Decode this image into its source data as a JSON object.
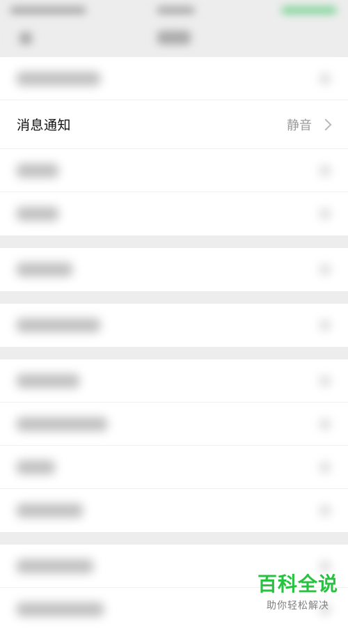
{
  "settings_list": {
    "message_notification": {
      "label": "消息通知",
      "value": "静音"
    }
  },
  "watermark": {
    "title": "百科全说",
    "subtitle": "助你轻松解决"
  }
}
